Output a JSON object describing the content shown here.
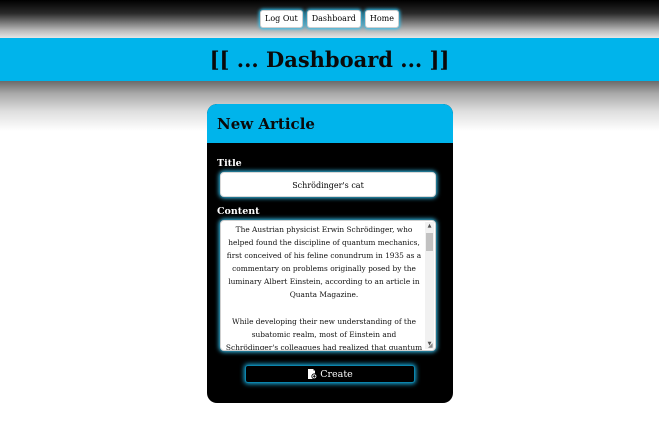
{
  "nav": {
    "logout_label": "Log Out",
    "dashboard_label": "Dashboard",
    "home_label": "Home"
  },
  "banner": {
    "title": "[[ ... Dashboard ... ]]"
  },
  "form": {
    "header": "New Article",
    "title_label": "Title",
    "title_value": "Schrödinger's cat",
    "content_label": "Content",
    "content_paragraphs": [
      "The Austrian physicist Erwin Schrödinger, who helped found the discipline of quantum mechanics, first conceived of his feline conundrum in 1935 as a commentary on problems originally posed by the luminary Albert Einstein, according to an article in Quanta Magazine.",
      "While developing their new understanding of the subatomic realm, most of Einstein and Schrödinger's colleagues had realized that quantum entities exhibited"
    ],
    "create_label": "Create",
    "create_icon": "file-plus-icon"
  },
  "colors": {
    "accent": "#00b4eb",
    "card_background": "#000000",
    "glow": "#37c6f5"
  }
}
